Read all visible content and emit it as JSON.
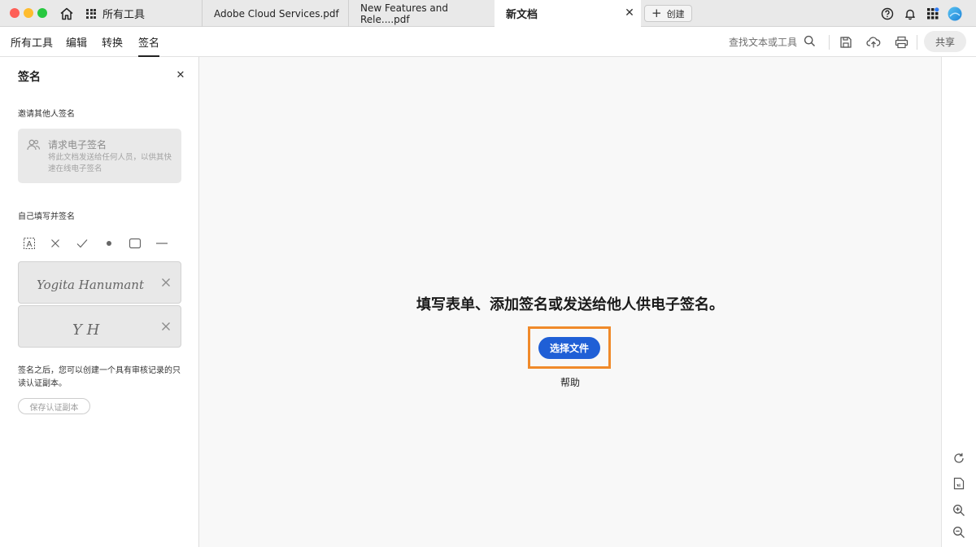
{
  "tabs": {
    "all_tools": "所有工具",
    "doc1": "Adobe Cloud Services.pdf",
    "doc2": "New Features and Rele....pdf",
    "active": "新文档",
    "create": "创建"
  },
  "toolbar": {
    "menu": [
      "所有工具",
      "编辑",
      "转换",
      "签名"
    ],
    "active_menu": "签名",
    "search_label": "查找文本或工具",
    "share": "共享"
  },
  "sign_panel": {
    "title": "签名",
    "invite_label": "邀请其他人签名",
    "request_title": "请求电子签名",
    "request_desc": "将此文档发送给任何人员，以供其快速在线电子签名",
    "self_label": "自己填写并签名",
    "signatures": [
      "Yogita Hanumant",
      "Y H"
    ],
    "cert_text": "签名之后，您可以创建一个具有审核记录的只读认证副本。",
    "save_cert": "保存认证副本"
  },
  "main": {
    "headline": "填写表单、添加签名或发送给他人供电子签名。",
    "choose_file": "选择文件",
    "help": "帮助"
  },
  "colors": {
    "accent_blue": "#1f5fd6",
    "highlight_orange": "#f08a2a"
  }
}
